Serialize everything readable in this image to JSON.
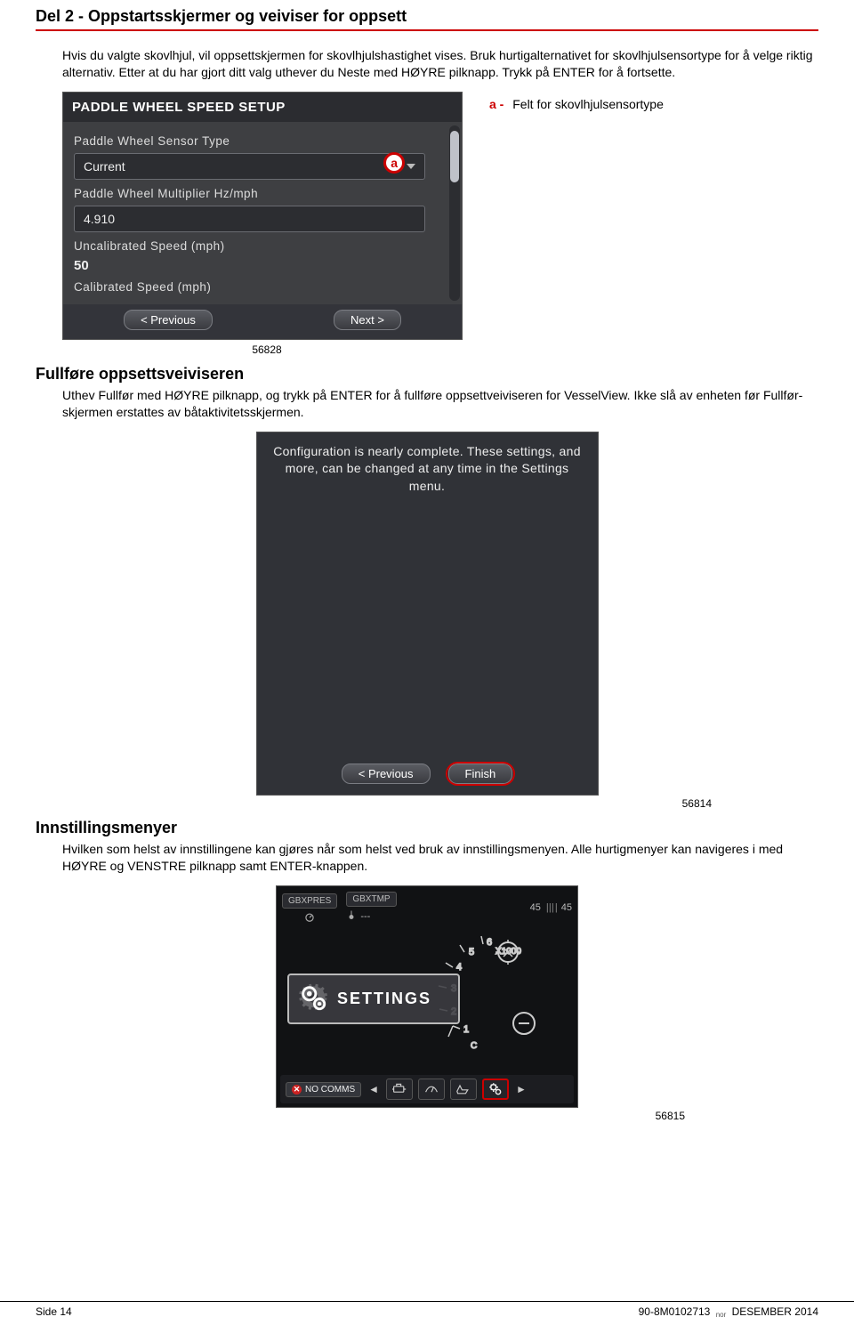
{
  "header": {
    "title": "Del 2 - Oppstartsskjermer og veiviser for oppsett"
  },
  "intro": {
    "p1": "Hvis du valgte skovlhjul, vil oppsettskjermen for skovlhjulshastighet vises. Bruk hurtigalternativet for skovlhjulsensortype for å velge riktig alternativ. Etter at du har gjort ditt valg uthever du Neste med HØYRE pilknapp. Trykk på ENTER for å fortsette."
  },
  "screen1": {
    "title": "PADDLE WHEEL SPEED SETUP",
    "fields": {
      "sensor_type_label": "Paddle Wheel Sensor Type",
      "sensor_type_value": "Current",
      "multiplier_label": "Paddle Wheel Multiplier Hz/mph",
      "multiplier_value": "4.910",
      "uncal_label": "Uncalibrated Speed (mph)",
      "uncal_value": "50",
      "cal_label": "Calibrated Speed (mph)"
    },
    "buttons": {
      "prev": "< Previous",
      "next": "Next >"
    },
    "marker": "a"
  },
  "legend_a": {
    "label": "a -",
    "text": "Felt for skovlhjulsensortype"
  },
  "fig1": {
    "caption": "56828"
  },
  "sect2": {
    "heading": "Fullføre oppsettsveiviseren",
    "p": "Uthev Fullfør med HØYRE pilknapp, og trykk på ENTER for å fullføre oppsettveiviseren for VesselView. Ikke slå av enheten før Fullfør-skjermen erstattes av båtaktivitetsskjermen."
  },
  "screen2": {
    "text": "Configuration is nearly complete. These settings, and more, can be changed at any time in the Settings menu.",
    "buttons": {
      "prev": "< Previous",
      "finish": "Finish"
    }
  },
  "fig2": {
    "caption": "56814"
  },
  "sect3": {
    "heading": "Innstillingsmenyer",
    "p": "Hvilken som helst av innstillingene kan gjøres når som helst ved bruk av innstillingsmenyen. Alle hurtigmenyer kan navigeres i med HØYRE og VENSTRE pilknapp samt ENTER-knappen."
  },
  "screen3": {
    "topbar": {
      "left1": "GBXPRES",
      "left2": "GBXTMP",
      "left2_val": "---",
      "right1": "45",
      "right2": "45"
    },
    "dial": {
      "x1000": "X1000",
      "ticks": [
        "1",
        "2",
        "3",
        "4",
        "5",
        "6"
      ],
      "sublabel": "C"
    },
    "overlay": "SETTINGS",
    "bottombar": {
      "nocomms": "NO COMMS",
      "arrows": {
        "left": "◄",
        "right": "►"
      }
    }
  },
  "fig3": {
    "caption": "56815"
  },
  "footer": {
    "left": "Side  14",
    "right_code": "90-8M0102713",
    "right_lang": "nor",
    "right_date": "DESEMBER  2014"
  }
}
